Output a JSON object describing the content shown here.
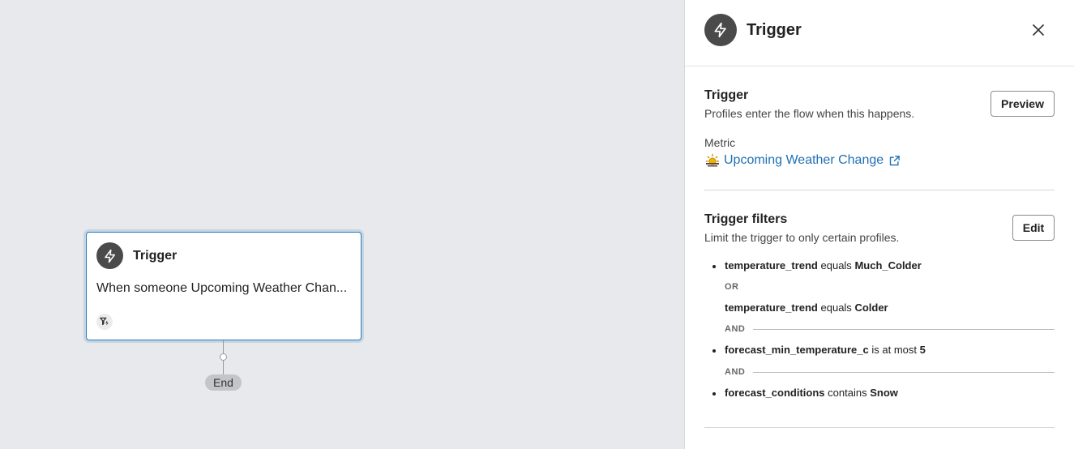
{
  "canvas": {
    "node": {
      "title": "Trigger",
      "description": "When someone Upcoming Weather Chan..."
    },
    "end_label": "End"
  },
  "panel": {
    "title": "Trigger",
    "trigger_section": {
      "title": "Trigger",
      "subtitle": "Profiles enter the flow when this happens.",
      "preview_button": "Preview",
      "metric_label": "Metric",
      "metric_name": "Upcoming Weather Change"
    },
    "filters_section": {
      "title": "Trigger filters",
      "subtitle": "Limit the trigger to only certain profiles.",
      "edit_button": "Edit",
      "conditions": [
        {
          "field": "temperature_trend",
          "operator": "equals",
          "value": "Much_Colder"
        },
        {
          "joiner": "OR"
        },
        {
          "field": "temperature_trend",
          "operator": "equals",
          "value": "Colder"
        },
        {
          "joiner": "AND"
        },
        {
          "field": "forecast_min_temperature_c",
          "operator": "is at most",
          "value": "5"
        },
        {
          "joiner": "AND"
        },
        {
          "field": "forecast_conditions",
          "operator": "contains",
          "value": "Snow"
        }
      ]
    }
  },
  "colors": {
    "accent_blue": "#1f6fb5",
    "node_border": "#2b7bb9",
    "icon_dark": "#4a4a4a"
  }
}
